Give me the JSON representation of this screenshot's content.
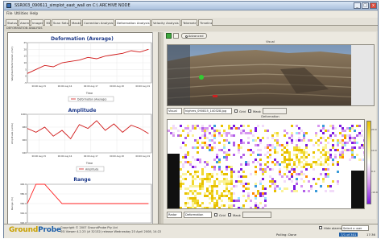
{
  "window": {
    "title": "SSR003_090611_simplot_east_wall on C:\\ ARCHIVE NODE",
    "min": "_",
    "max": "□",
    "close": "x"
  },
  "menu": [
    "File",
    "Utilities",
    "Help"
  ],
  "tabs": [
    "Status",
    "Alarms",
    "Images",
    "3D",
    "Scan Setup",
    "Masks",
    "Correction Analysis",
    "Deformation Analysis",
    "Velocity Analysis",
    "Telemetry",
    "Timeline"
  ],
  "active_tab": "Deformation Analysis",
  "subheader": "DEFORMATION ANALYSIS",
  "left": {
    "deformation": {
      "title": "Deformation (Average)",
      "ylabel": "Weighted Deformation (mm)",
      "xlabel": "Time",
      "legend": "Deformation (Average)",
      "yticks": [
        "25",
        "20",
        "15",
        "10",
        "5",
        "0",
        "-5"
      ],
      "xticks": [
        "00:00 Aug 15",
        "00:00 Aug 16",
        "00:00 Aug 17",
        "00:00 Aug 18",
        "00:00 Aug 19"
      ]
    },
    "amplitude": {
      "title": "Amplitude",
      "ylabel": "Amplitude (units)",
      "xlabel": "Time",
      "legend": "Amplitude",
      "yticks": [
        "1000",
        "980",
        "960",
        "940"
      ],
      "xticks": [
        "00:00 Aug 15",
        "00:00 Aug 16",
        "00:00 Aug 17",
        "00:00 Aug 18",
        "00:00 Aug 19"
      ]
    },
    "range": {
      "title": "Range",
      "ylabel": "Range (m)",
      "yticks": [
        "400.0",
        "380.0",
        "360.0",
        "340.0",
        "320.0"
      ]
    }
  },
  "toolbar": {
    "advanced_label": "Advanced"
  },
  "visual": {
    "panel_label": "Visual",
    "type": "Visual",
    "file": "highres_090815_140328.jpg",
    "grid_label": "Grid",
    "mask_label": "Mask"
  },
  "deformation_map": {
    "panel_label": "Deformation",
    "source": "Radar",
    "mode": "Deformation",
    "grid_label": "Grid",
    "mask_label": "Mask",
    "scale_ticks": [
      "20.0",
      "10.0",
      "0.0",
      "-10.0",
      "-20.0"
    ]
  },
  "footer": {
    "logo_ground": "Ground",
    "logo_probe": "Probe",
    "copyright": "Copyright © 2007 GroundProbe Pty Ltd",
    "version": "SSI Viewer 4.2.23 (# 32132) release Wednesday 23 April 2008, 14:22",
    "hide_alarms": "Hide alarms",
    "select_user": "Select a user",
    "polling": "Polling: Done",
    "position": "7/1 of 301",
    "time": "17:36"
  },
  "colors": {
    "deform_series": "#d01818",
    "amplitude_series": "#d01818",
    "range_series": "#ff2020",
    "accent": "#1e5fa8",
    "logo_yellow": "#c8a000"
  },
  "chart_data": [
    {
      "type": "line",
      "title": "Deformation (Average)",
      "xlabel": "Time",
      "ylabel": "Weighted Deformation (mm)",
      "series": [
        {
          "name": "Deformation (Average)",
          "x": [
            0,
            0.3,
            0.6,
            0.9,
            1.2,
            1.5,
            1.8,
            2.1,
            2.4,
            2.7,
            3.0,
            3.3,
            3.6,
            3.9,
            4.2
          ],
          "values": [
            2,
            5,
            8,
            7,
            10,
            11,
            12,
            14,
            13,
            15,
            16,
            17,
            19,
            18,
            20
          ]
        }
      ],
      "ylim": [
        -5,
        25
      ]
    },
    {
      "type": "line",
      "title": "Amplitude",
      "xlabel": "Time",
      "ylabel": "Amplitude (units)",
      "series": [
        {
          "name": "Amplitude",
          "x": [
            0,
            0.3,
            0.6,
            0.9,
            1.2,
            1.5,
            1.8,
            2.1,
            2.4,
            2.7,
            3.0,
            3.3,
            3.6,
            3.9,
            4.2
          ],
          "values": [
            978,
            972,
            980,
            966,
            975,
            962,
            984,
            978,
            990,
            975,
            985,
            972,
            983,
            978,
            970
          ]
        }
      ],
      "ylim": [
        940,
        1000
      ]
    },
    {
      "type": "line",
      "title": "Range",
      "ylabel": "Range (m)",
      "series": [
        {
          "name": "",
          "x": [
            0,
            0.3,
            0.6,
            1.2,
            4.2
          ],
          "values": [
            360,
            400,
            400,
            360,
            360
          ]
        }
      ],
      "ylim": [
        320,
        400
      ]
    }
  ]
}
